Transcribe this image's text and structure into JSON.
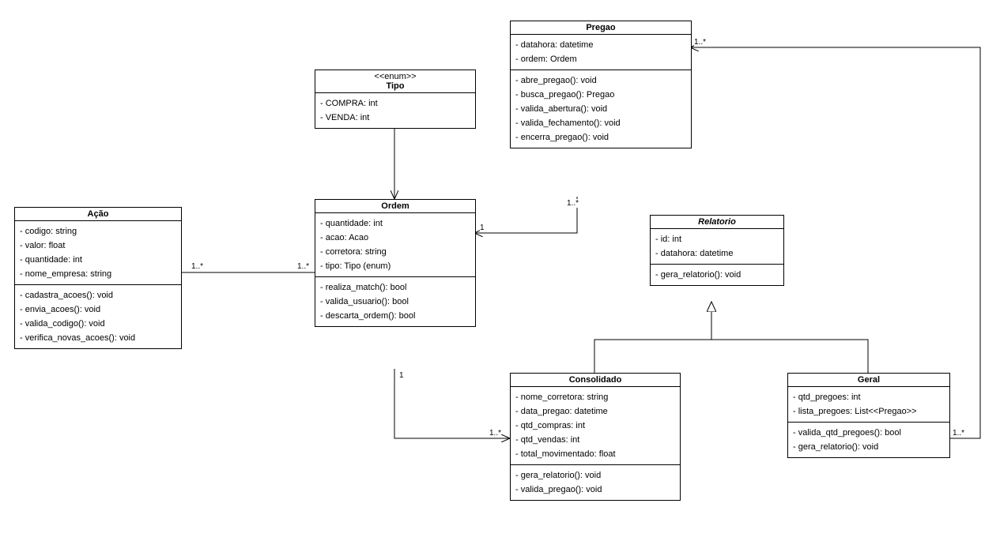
{
  "classes": {
    "acao": {
      "title": "Ação",
      "attrs": [
        "- codigo: string",
        "- valor: float",
        "- quantidade: int",
        "- nome_empresa: string"
      ],
      "ops": [
        "- cadastra_acoes(): void",
        "- envia_acoes(): void",
        "- valida_codigo(): void",
        "- verifica_novas_acoes(): void"
      ]
    },
    "tipo": {
      "stereotype": "<<enum>>",
      "title": "Tipo",
      "attrs": [
        "- COMPRA: int",
        "- VENDA: int"
      ]
    },
    "ordem": {
      "title": "Ordem",
      "attrs": [
        "- quantidade: int",
        "- acao: Acao",
        "- corretora: string",
        "- tipo: Tipo (enum)"
      ],
      "ops": [
        "- realiza_match(): bool",
        "- valida_usuario(): bool",
        "- descarta_ordem(): bool"
      ]
    },
    "pregao": {
      "title": "Pregao",
      "attrs": [
        "- datahora: datetime",
        "- ordem: Ordem"
      ],
      "ops": [
        "- abre_pregao(): void",
        "- busca_pregao(): Pregao",
        "- valida_abertura(): void",
        "- valida_fechamento(): void",
        "- encerra_pregao(): void"
      ]
    },
    "relatorio": {
      "title": "Relatorio",
      "italic": true,
      "attrs": [
        "- id: int",
        "- datahora: datetime"
      ],
      "ops": [
        "- gera_relatorio(): void"
      ]
    },
    "consolidado": {
      "title": "Consolidado",
      "attrs": [
        "- nome_corretora: string",
        "- data_pregao: datetime",
        "- qtd_compras: int",
        "- qtd_vendas: int",
        "- total_movimentado: float"
      ],
      "ops": [
        "- gera_relatorio(): void",
        "- valida_pregao(): void"
      ]
    },
    "geral": {
      "title": "Geral",
      "attrs": [
        "- qtd_pregoes: int",
        "- lista_pregoes: List<<Pregao>>"
      ],
      "ops": [
        "- valida_qtd_pregoes(): bool",
        "- gera_relatorio(): void"
      ]
    }
  },
  "multiplicities": {
    "acao_ordem_left": "1..*",
    "acao_ordem_right": "1..*",
    "ordem_pregao_ordem": "1",
    "ordem_pregao_pregao": "1..*",
    "ordem_consolidado_ordem": "1",
    "ordem_consolidado_cons": "1..*",
    "geral_pregao_geral": "1..*",
    "geral_pregao_pregao": "1..*"
  }
}
